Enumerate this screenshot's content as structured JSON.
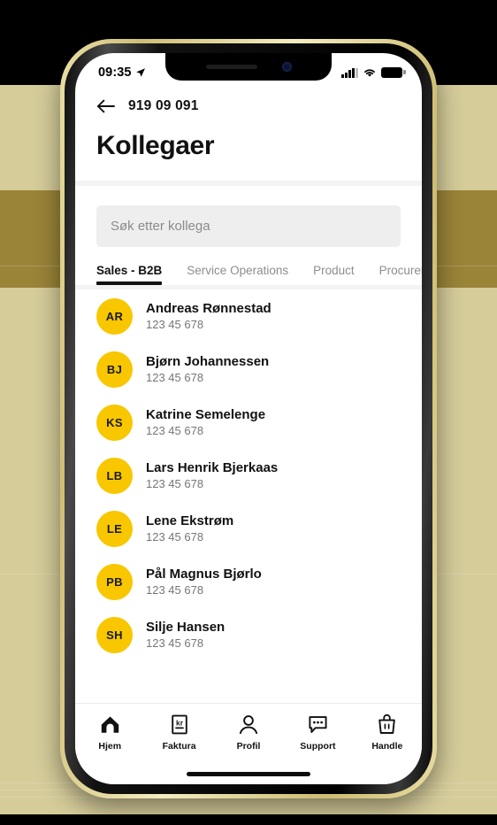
{
  "status_bar": {
    "time": "09:35",
    "location_icon": "location-arrow-icon",
    "signal_icon": "cellular-signal-icon",
    "wifi_icon": "wifi-icon",
    "battery_icon": "battery-full-icon"
  },
  "header": {
    "back_icon": "back-arrow-icon",
    "nav_title": "919 09 091",
    "page_title": "Kollegaer"
  },
  "search": {
    "placeholder": "Søk etter kollega",
    "value": ""
  },
  "tabs": [
    {
      "label": "Sales - B2B",
      "active": true
    },
    {
      "label": "Service Operations",
      "active": false
    },
    {
      "label": "Product",
      "active": false
    },
    {
      "label": "Procurement",
      "active": false
    }
  ],
  "colors": {
    "avatar_yellow": "#F8C700",
    "text_primary": "#111111",
    "text_secondary": "#767676",
    "search_background": "#EEEEEE",
    "frame_gold": "#CFBE74",
    "backdrop_khaki": "#D5CC9A",
    "backdrop_gold_band": "#9A8438"
  },
  "colleagues": [
    {
      "initials": "AR",
      "name": "Andreas Rønnestad",
      "phone": "123 45 678"
    },
    {
      "initials": "BJ",
      "name": "Bjørn Johannessen",
      "phone": "123 45 678"
    },
    {
      "initials": "KS",
      "name": "Katrine Semelenge",
      "phone": "123 45 678"
    },
    {
      "initials": "LB",
      "name": "Lars Henrik Bjerkaas",
      "phone": "123 45 678"
    },
    {
      "initials": "LE",
      "name": "Lene Ekstrøm",
      "phone": "123 45 678"
    },
    {
      "initials": "PB",
      "name": "Pål Magnus Bjørlo",
      "phone": "123 45 678"
    },
    {
      "initials": "SH",
      "name": "Silje Hansen",
      "phone": "123 45 678"
    }
  ],
  "bottom_nav": [
    {
      "label": "Hjem",
      "icon": "home-icon"
    },
    {
      "label": "Faktura",
      "icon": "invoice-kr-icon"
    },
    {
      "label": "Profil",
      "icon": "person-icon"
    },
    {
      "label": "Support",
      "icon": "chat-bubble-icon"
    },
    {
      "label": "Handle",
      "icon": "shopping-basket-icon"
    }
  ]
}
